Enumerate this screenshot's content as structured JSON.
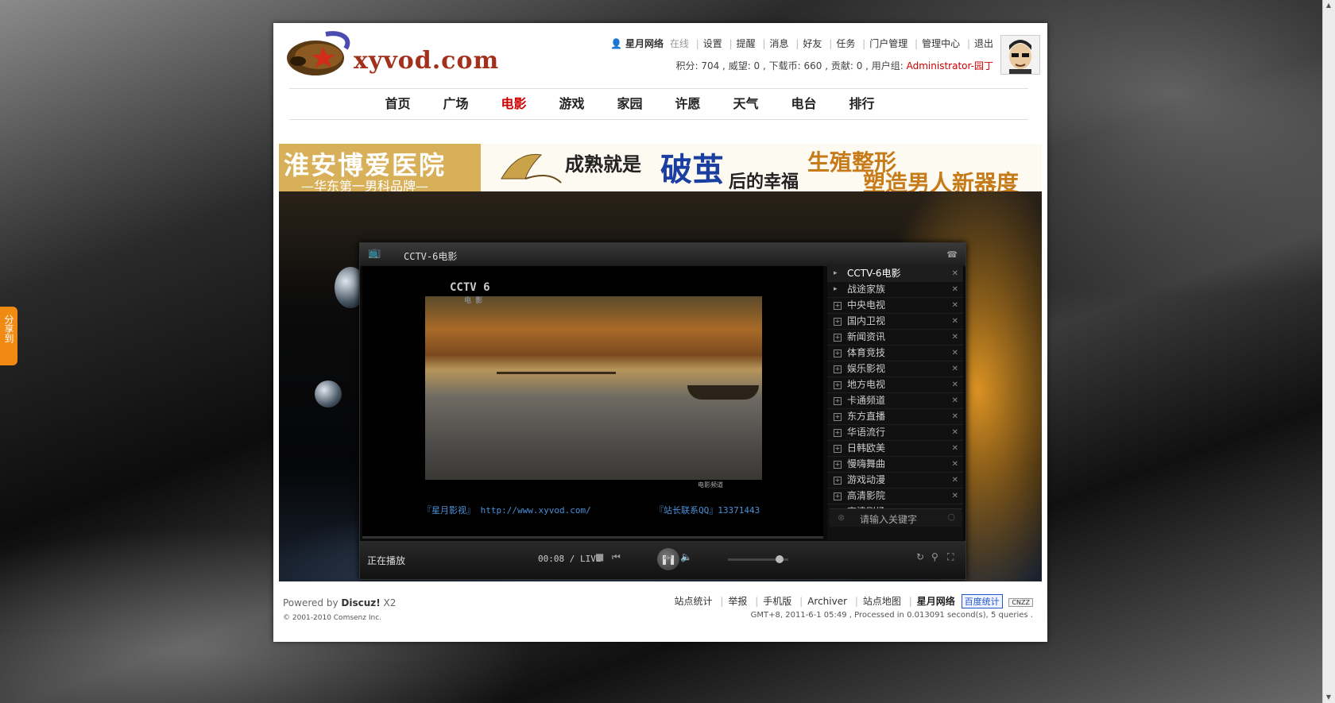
{
  "site": {
    "logo_text": "xyvod.com"
  },
  "userbar": {
    "username": "星月网络",
    "status": "在线",
    "links": [
      "设置",
      "提醒",
      "消息",
      "好友",
      "任务",
      "门户管理",
      "管理中心",
      "退出"
    ],
    "stats_text": "积分: 704 , 威望: 0 , 下载币: 660 , 贡献: 0 , 用户组: ",
    "group": "Administrator-园丁"
  },
  "nav": {
    "items": [
      "首页",
      "广场",
      "电影",
      "游戏",
      "家园",
      "许愿",
      "天气",
      "电台",
      "排行"
    ],
    "active_index": 2
  },
  "banner": {
    "left_title": "淮安博爱医院",
    "left_sub": "—华东第一男科品牌—",
    "slogan1": "成熟就是",
    "slogan2": "破茧",
    "slogan3": "后的幸福",
    "slogan4": "生殖整形",
    "slogan5": "塑造男人新器度"
  },
  "player": {
    "title": "CCTV-6电影",
    "logo": "CCTV 6",
    "logo_sub": "电 影",
    "watermark": "电影频道",
    "footer_left": "『星月影视』 http://www.xyvod.com/",
    "footer_right": "『站长联系QQ』13371443",
    "status": "正在播放",
    "time": "00:08 / LIVE",
    "search_placeholder": "请输入关键字",
    "volume_level": 0.85,
    "channels": [
      {
        "name": "CCTV-6电影",
        "type": "play",
        "current": true
      },
      {
        "name": "战途家族",
        "type": "play",
        "current": false
      },
      {
        "name": "中央电视",
        "type": "folder",
        "current": false
      },
      {
        "name": "国内卫视",
        "type": "folder",
        "current": false
      },
      {
        "name": "新闻资讯",
        "type": "folder",
        "current": false
      },
      {
        "name": "体育竞技",
        "type": "folder",
        "current": false
      },
      {
        "name": "娱乐影视",
        "type": "folder",
        "current": false
      },
      {
        "name": "地方电视",
        "type": "folder",
        "current": false
      },
      {
        "name": "卡通频道",
        "type": "folder",
        "current": false
      },
      {
        "name": "东方直播",
        "type": "folder",
        "current": false
      },
      {
        "name": "华语流行",
        "type": "folder",
        "current": false
      },
      {
        "name": "日韩欧美",
        "type": "folder",
        "current": false
      },
      {
        "name": "慢嗨舞曲",
        "type": "folder",
        "current": false
      },
      {
        "name": "游戏动漫",
        "type": "folder",
        "current": false
      },
      {
        "name": "高清影院",
        "type": "folder",
        "current": false
      },
      {
        "name": "高清剧场",
        "type": "folder",
        "current": false
      }
    ]
  },
  "footer": {
    "powered_prefix": "Powered by ",
    "powered_name": "Discuz!",
    "powered_version": " X2",
    "copyright": "© 2001-2010 Comsenz Inc.",
    "links": [
      "站点统计",
      "举报",
      "手机版",
      "Archiver",
      "站点地图"
    ],
    "brand": "星月网络",
    "baidu": "百度统计",
    "cnzz": "CNZZ",
    "meta": "GMT+8, 2011-6-1 05:49 , Processed in 0.013091 second(s), 5 queries ."
  },
  "share": {
    "label": "分享到"
  }
}
